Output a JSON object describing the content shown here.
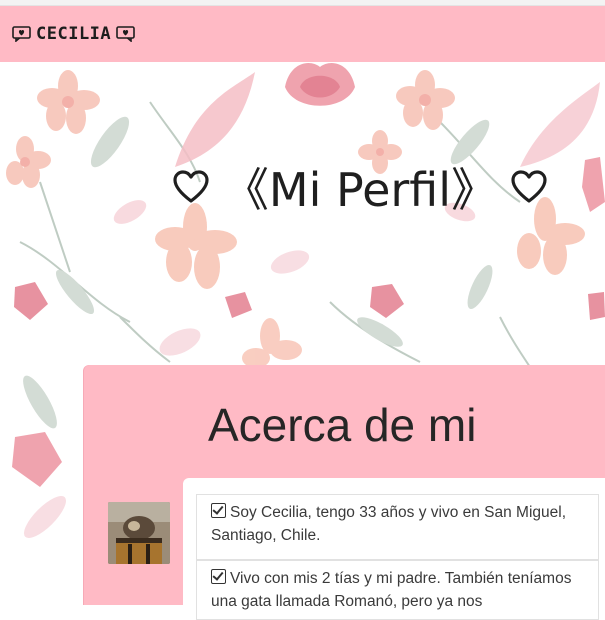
{
  "navbar": {
    "brand": "CECILIA",
    "brand_icon_left": "speech-bubble-heart-icon",
    "brand_icon_right": "speech-bubble-heart-icon"
  },
  "hero": {
    "title": "《Mi Perfil》",
    "heart_icon": "heart-outline-icon"
  },
  "about": {
    "title": "Acerca de mi",
    "items": [
      {
        "text": "Soy Cecilia, tengo 33 años y vivo en San Miguel, Santiago, Chile."
      },
      {
        "text": "Vivo con mis 2 tías y mi padre. También teníamos una gata llamada Romanó, pero ya nos"
      }
    ]
  },
  "colors": {
    "accent_pink": "#ffbac5",
    "text_dark": "#1f1f1f"
  }
}
